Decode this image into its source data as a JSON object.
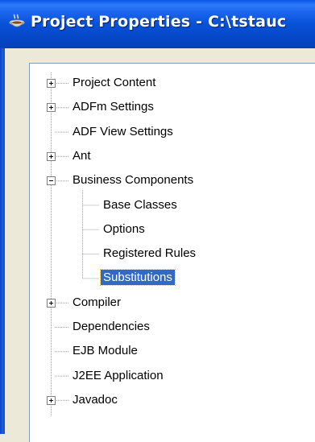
{
  "window": {
    "title": "Project Properties - C:\\tstauc"
  },
  "tree": {
    "nodes": [
      {
        "label": "Project Content",
        "level": 0,
        "toggle": "plus"
      },
      {
        "label": "ADFm Settings",
        "level": 0,
        "toggle": "plus"
      },
      {
        "label": "ADF View Settings",
        "level": 0,
        "toggle": "none"
      },
      {
        "label": "Ant",
        "level": 0,
        "toggle": "plus"
      },
      {
        "label": "Business Components",
        "level": 0,
        "toggle": "minus"
      },
      {
        "label": "Base Classes",
        "level": 1,
        "toggle": "none"
      },
      {
        "label": "Options",
        "level": 1,
        "toggle": "none"
      },
      {
        "label": "Registered Rules",
        "level": 1,
        "toggle": "none"
      },
      {
        "label": "Substitutions",
        "level": 1,
        "toggle": "none",
        "selected": true
      },
      {
        "label": "Compiler",
        "level": 0,
        "toggle": "plus"
      },
      {
        "label": "Dependencies",
        "level": 0,
        "toggle": "none"
      },
      {
        "label": "EJB Module",
        "level": 0,
        "toggle": "none"
      },
      {
        "label": "J2EE Application",
        "level": 0,
        "toggle": "none"
      },
      {
        "label": "Javadoc",
        "level": 0,
        "toggle": "plus"
      }
    ]
  },
  "colors": {
    "titlebar": "#0645c3",
    "selection": "#316ac5",
    "dialog": "#ece9d8"
  },
  "icons": {
    "app": "coffee-cup-icon",
    "expand": "plus-box-icon",
    "collapse": "minus-box-icon"
  }
}
